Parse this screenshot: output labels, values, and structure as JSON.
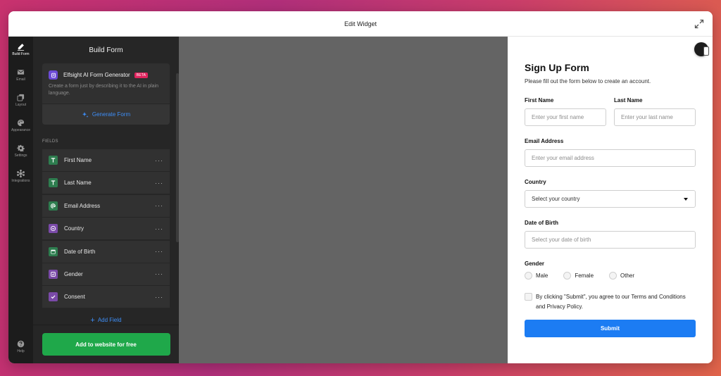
{
  "window": {
    "title": "Edit Widget"
  },
  "icon_nav": {
    "items": [
      {
        "label": "Build Form",
        "icon": "pencil-icon",
        "active": true
      },
      {
        "label": "Email",
        "icon": "envelope-icon",
        "active": false
      },
      {
        "label": "Layout",
        "icon": "layout-icon",
        "active": false
      },
      {
        "label": "Appearance",
        "icon": "palette-icon",
        "active": false
      },
      {
        "label": "Settings",
        "icon": "gear-icon",
        "active": false
      },
      {
        "label": "Integrations",
        "icon": "integrations-icon",
        "active": false
      }
    ],
    "help_label": "Help"
  },
  "panel": {
    "title": "Build Form",
    "ai_card": {
      "title": "Elfsight AI Form Generator",
      "badge": "BETA",
      "description": "Create a form just by describing it to the AI in plain language.",
      "generate_label": "Generate Form"
    },
    "fields_heading": "FIELDS",
    "fields": [
      {
        "label": "First Name",
        "icon": "text-field-icon",
        "color": "#2e7d4f"
      },
      {
        "label": "Last Name",
        "icon": "text-field-icon",
        "color": "#2e7d4f"
      },
      {
        "label": "Email Address",
        "icon": "at-sign-icon",
        "color": "#2e7d4f"
      },
      {
        "label": "Country",
        "icon": "dropdown-icon",
        "color": "#7a4aa8"
      },
      {
        "label": "Date of Birth",
        "icon": "calendar-icon",
        "color": "#2e7d4f"
      },
      {
        "label": "Gender",
        "icon": "radio-select-icon",
        "color": "#7a4aa8"
      },
      {
        "label": "Consent",
        "icon": "checkmark-icon",
        "color": "#7a4aa8"
      }
    ],
    "more_label": "···",
    "add_field_label": "Add Field",
    "publish_label": "Add to website for free"
  },
  "form": {
    "title": "Sign Up Form",
    "description": "Please fill out the form below to create an account.",
    "first_name": {
      "label": "First Name",
      "placeholder": "Enter your first name"
    },
    "last_name": {
      "label": "Last Name",
      "placeholder": "Enter your last name"
    },
    "email": {
      "label": "Email Address",
      "placeholder": "Enter your email address"
    },
    "country": {
      "label": "Country",
      "value": "Select your country"
    },
    "dob": {
      "label": "Date of Birth",
      "placeholder": "Select your date of birth"
    },
    "gender": {
      "label": "Gender",
      "options": [
        "Male",
        "Female",
        "Other"
      ]
    },
    "consent_text": "By clicking \"Submit\", you agree to our Terms and Conditions and Privacy Policy.",
    "submit_label": "Submit"
  },
  "colors": {
    "accent_blue": "#1c7cf3",
    "publish_green": "#1fa84a",
    "beta_pink": "#e0245e",
    "canvas_gray": "#646464"
  }
}
